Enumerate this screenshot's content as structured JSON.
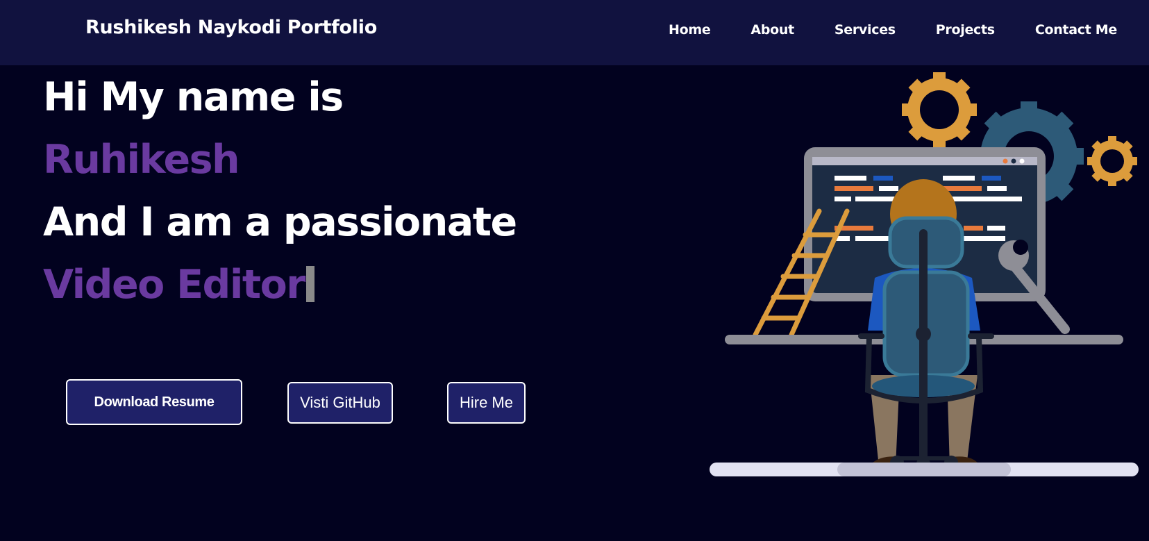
{
  "header": {
    "brand": "Rushikesh Naykodi Portfolio",
    "nav": [
      "Home",
      "About",
      "Services",
      "Projects",
      "Contact Me"
    ]
  },
  "hero": {
    "line1": "Hi My name is",
    "name": "Ruhikesh",
    "line3": "And I am a passionate",
    "role": "Video Editor"
  },
  "buttons": {
    "resume": "Download Resume",
    "github": "Visti GitHub",
    "hire": "Hire Me"
  },
  "illustration": {
    "icon": "developer-at-desk-illustration"
  },
  "colors": {
    "background": "#02021f",
    "navbar": "#11123f",
    "accent_purple": "#6a3aa0",
    "button_bg": "#1f2168",
    "gear_orange": "#dc9c3c",
    "gear_blue": "#2d5a78"
  }
}
